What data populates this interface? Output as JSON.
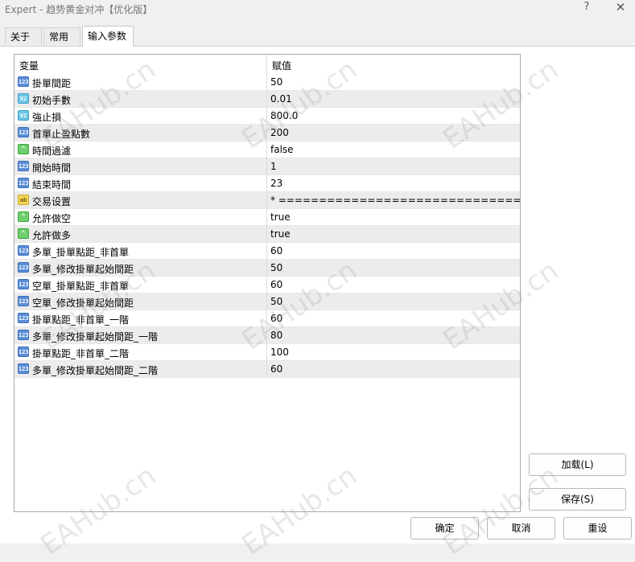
{
  "window": {
    "title": "Expert - 趋势黄金对冲【优化版】",
    "help_label": "?",
    "close_label": "✕"
  },
  "tabs": [
    {
      "label": "关于",
      "active": false
    },
    {
      "label": "常用",
      "active": false
    },
    {
      "label": "输入参数",
      "active": true
    }
  ],
  "grid": {
    "headers": {
      "variable": "变量",
      "value": "赋值"
    },
    "rows": [
      {
        "type": "int",
        "icon": "123",
        "name": "掛單間距",
        "value": "50"
      },
      {
        "type": "double",
        "icon": "V2",
        "name": "初始手數",
        "value": "0.01"
      },
      {
        "type": "double",
        "icon": "V2",
        "name": "強止損",
        "value": "800.0"
      },
      {
        "type": "int",
        "icon": "123",
        "name": "首單止盈點數",
        "value": "200"
      },
      {
        "type": "bool",
        "icon": "⌃",
        "name": "時間過濾",
        "value": "false"
      },
      {
        "type": "int",
        "icon": "123",
        "name": "開始時間",
        "value": "1"
      },
      {
        "type": "int",
        "icon": "123",
        "name": "結束時間",
        "value": "23"
      },
      {
        "type": "string",
        "icon": "ab",
        "name": "交易设置",
        "value": "* =============================== *"
      },
      {
        "type": "bool",
        "icon": "⌃",
        "name": "允許做空",
        "value": "true"
      },
      {
        "type": "bool",
        "icon": "⌃",
        "name": "允許做多",
        "value": "true"
      },
      {
        "type": "int",
        "icon": "123",
        "name": "多單_掛單點距_非首單",
        "value": "60"
      },
      {
        "type": "int",
        "icon": "123",
        "name": "多單_修改掛單起始間距",
        "value": "50"
      },
      {
        "type": "int",
        "icon": "123",
        "name": "空單_掛單點距_非首單",
        "value": "60"
      },
      {
        "type": "int",
        "icon": "123",
        "name": "空單_修改掛單起始間距",
        "value": "50"
      },
      {
        "type": "int",
        "icon": "123",
        "name": "掛單點距_非首單_一階",
        "value": "60"
      },
      {
        "type": "int",
        "icon": "123",
        "name": "多單_修改掛單起始間距_一階",
        "value": "80"
      },
      {
        "type": "int",
        "icon": "123",
        "name": "掛單點距_非首單_二階",
        "value": "100"
      },
      {
        "type": "int",
        "icon": "123",
        "name": "多單_修改掛單起始間距_二階",
        "value": "60"
      }
    ]
  },
  "buttons": {
    "load": "加载(L)",
    "save": "保存(S)",
    "ok": "确定",
    "cancel": "取消",
    "reset": "重设"
  },
  "watermark": "EAHub.cn"
}
